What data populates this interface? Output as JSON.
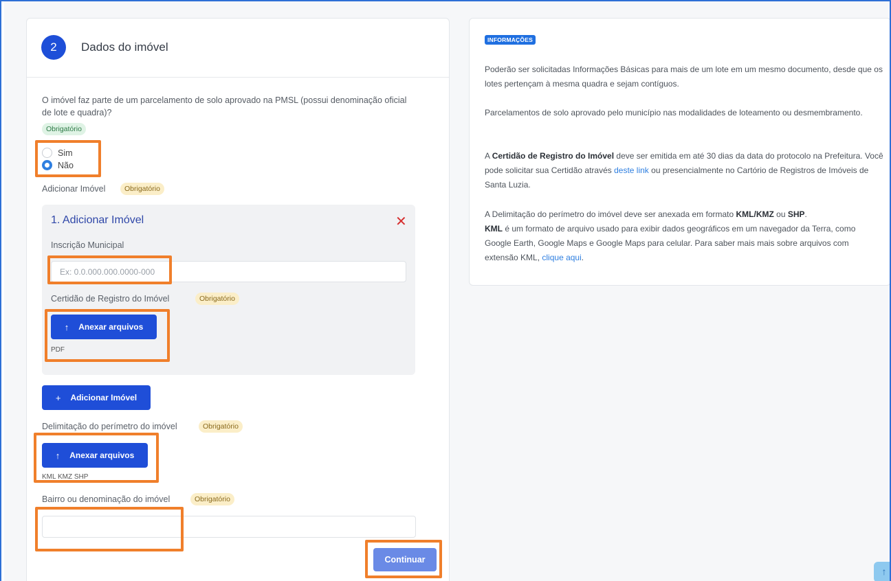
{
  "step": {
    "number": "2",
    "title": "Dados do imóvel"
  },
  "question": {
    "text": "O imóvel faz parte de um parcelamento de solo aprovado na PMSL (possui denominação oficial de lote e quadra)?",
    "required": "Obrigatório",
    "options": [
      {
        "label": "Sim",
        "checked": false
      },
      {
        "label": "Não",
        "checked": true
      }
    ]
  },
  "add_property": {
    "label": "Adicionar Imóvel",
    "required": "Obrigatório",
    "item": {
      "title": "1. Adicionar Imóvel",
      "close_icon": "close-icon",
      "inscricao_label": "Inscrição Municipal",
      "inscricao_placeholder": "Ex: 0.0.000.000.0000-000",
      "certidao_label": "Certidão de Registro do Imóvel",
      "certidao_required": "Obrigatório",
      "attach_label": "Anexar arquivos",
      "attach_formats": "PDF"
    },
    "add_button": "Adicionar Imóvel"
  },
  "perimeter": {
    "label": "Delimitação do perímetro do imóvel",
    "required": "Obrigatório",
    "attach_label": "Anexar arquivos",
    "formats": "KML KMZ SHP"
  },
  "bairro": {
    "label": "Bairro ou denominação do imóvel",
    "required": "Obrigatório",
    "value": ""
  },
  "continue_button": "Continuar",
  "info": {
    "badge": "INFORMAÇÕES",
    "p1": "Poderão ser solicitadas Informações Básicas para mais de um lote em um mesmo documento, desde que os lotes pertençam à mesma quadra e sejam contíguos.",
    "p2": "Parcelamentos de solo aprovado pelo município nas modalidades de loteamento ou desmembramento.",
    "p3_a": "A ",
    "p3_bold": "Certidão de Registro do Imóvel",
    "p3_b": " deve ser emitida em até 30 dias da data do protocolo na Prefeitura. Você pode solicitar sua Certidão através ",
    "p3_link": "deste link",
    "p3_c": " ou presencialmente no Cartório de Registros de Imóveis de Santa Luzia.",
    "p4_a": "A Delimitação do perímetro do imóvel deve ser anexada em formato ",
    "p4_b1": "KML/KMZ",
    "p4_ou": " ou ",
    "p4_b2": "SHP",
    "p4_dot": ".",
    "p4_kml": "KML",
    "p4_c": " é um formato de arquivo usado para exibir dados geográficos em um navegador da Terra, como Google Earth, Google Maps e Google Maps para celular. Para saber mais mais sobre arquivos com extensão KML, ",
    "p4_link": "clique aqui",
    "p4_end": "."
  },
  "colors": {
    "primary": "#1f4ed8",
    "highlight": "#f07f2b",
    "danger": "#d62f2f",
    "link": "#2f7fe0"
  }
}
